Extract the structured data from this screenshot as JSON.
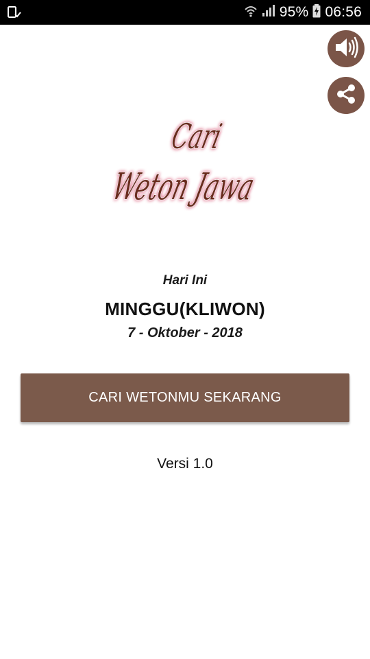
{
  "status_bar": {
    "battery": "95%",
    "time": "06:56",
    "icons": [
      "notification-icon",
      "wifi-icon",
      "signal-icon",
      "battery-icon"
    ]
  },
  "actions": {
    "sound_icon": "speaker-icon",
    "share_icon": "share-icon",
    "accent_color": "#7b5548"
  },
  "logo": {
    "line1": "Cari",
    "line2": "Weton Jawa"
  },
  "today": {
    "label": "Hari Ini",
    "day": "MINGGU(KLIWON)",
    "date": "7 - Oktober - 2018"
  },
  "main_button": {
    "label": "CARI WETONMU SEKARANG",
    "color": "#7b5a4b"
  },
  "version": "Versi 1.0"
}
